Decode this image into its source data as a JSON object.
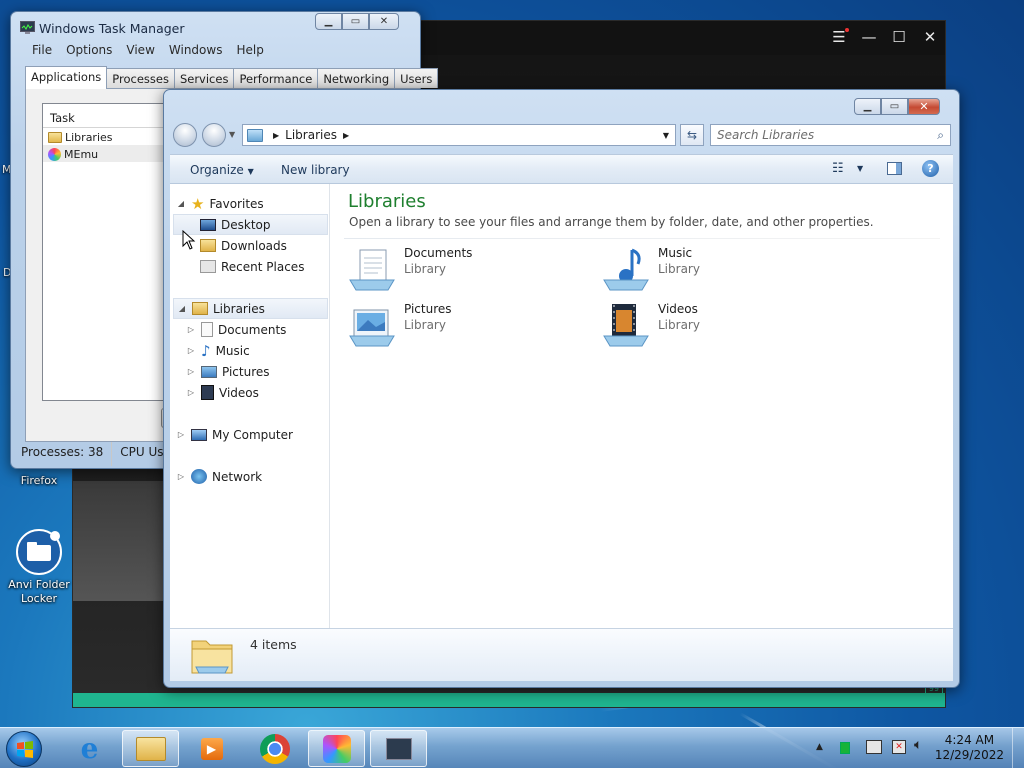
{
  "desktop": {
    "icons": [
      {
        "label": "Firefox"
      },
      {
        "label": "Anvi Folder Locker"
      }
    ],
    "partial_letters": [
      "M",
      "D"
    ]
  },
  "task_manager": {
    "title": "Windows Task Manager",
    "menu": [
      "File",
      "Options",
      "View",
      "Windows",
      "Help"
    ],
    "tabs": [
      "Applications",
      "Processes",
      "Services",
      "Performance",
      "Networking",
      "Users"
    ],
    "active_tab": "Applications",
    "list_header": "Task",
    "tasks": [
      "Libraries",
      "MEmu"
    ],
    "status": {
      "processes": "Processes: 38",
      "cpu": "CPU Us"
    }
  },
  "explorer": {
    "breadcrumb": [
      "Libraries"
    ],
    "search_placeholder": "Search Libraries",
    "toolbar": {
      "organize": "Organize",
      "new_library": "New library"
    },
    "nav": {
      "favorites": {
        "label": "Favorites",
        "items": [
          "Desktop",
          "Downloads",
          "Recent Places"
        ]
      },
      "libraries": {
        "label": "Libraries",
        "items": [
          "Documents",
          "Music",
          "Pictures",
          "Videos"
        ]
      },
      "computer": "My Computer",
      "network": "Network"
    },
    "heading": "Libraries",
    "subheading": "Open a library to see your files and arrange them by folder, date, and other properties.",
    "libraries": [
      {
        "name": "Documents",
        "type": "Library",
        "icon": "documents-library-icon"
      },
      {
        "name": "Music",
        "type": "Library",
        "icon": "music-library-icon"
      },
      {
        "name": "Pictures",
        "type": "Library",
        "icon": "pictures-library-icon"
      },
      {
        "name": "Videos",
        "type": "Library",
        "icon": "videos-library-icon"
      }
    ],
    "details": {
      "count": "4 items"
    }
  },
  "taskbar": {
    "clock": {
      "time": "4:24 AM",
      "date": "12/29/2022"
    }
  },
  "colors": {
    "library_heading": "#1e7f2e",
    "taskbar_top": "#aecdec",
    "emulator_accent": "#1fb58f"
  }
}
